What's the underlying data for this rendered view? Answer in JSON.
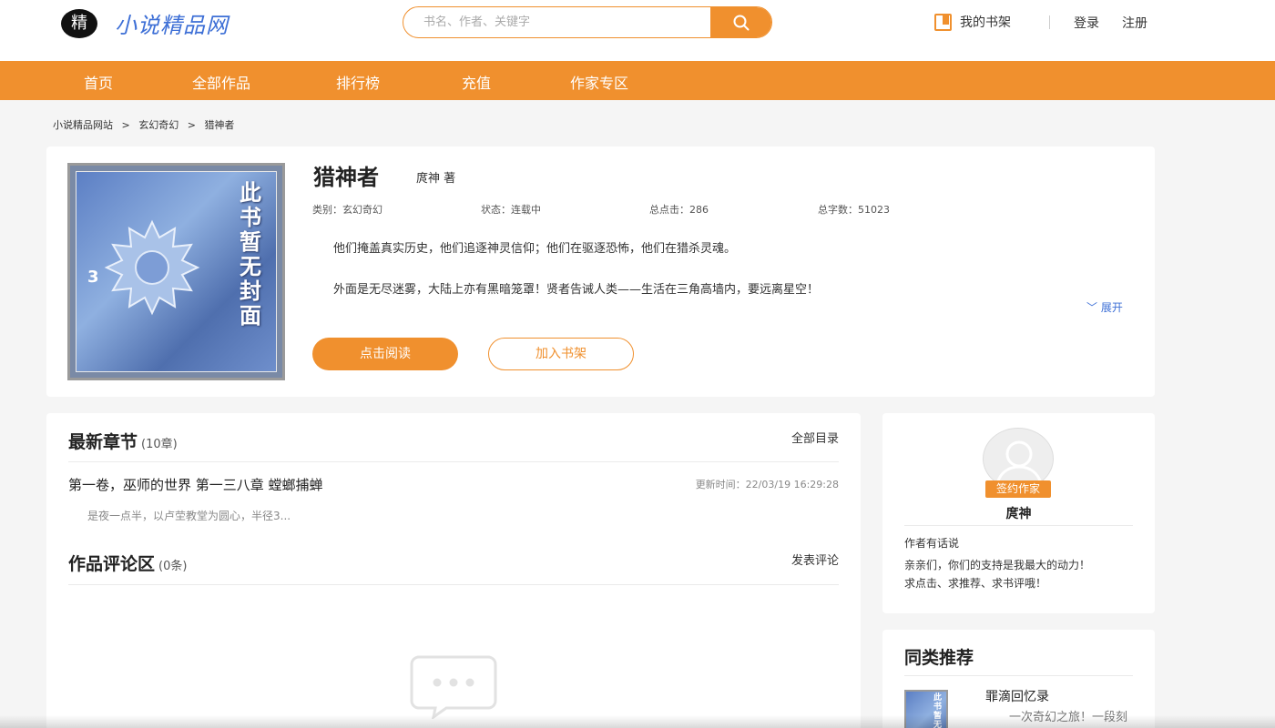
{
  "header": {
    "logo_badge": "精",
    "logo_text": "小说精品网",
    "search_placeholder": "书名、作者、关键字",
    "shelf_label": "我的书架",
    "login": "登录",
    "register": "注册"
  },
  "nav": {
    "items": [
      "首页",
      "全部作品",
      "排行榜",
      "充值",
      "作家专区"
    ]
  },
  "breadcrumb": [
    "小说精品网站",
    ">",
    "玄幻奇幻",
    ">",
    "猎神者"
  ],
  "book": {
    "title": "猎神者",
    "author": "庹神 著",
    "category": "类别：玄幻奇幻",
    "status": "状态：连载中",
    "clicks": "总点击：286",
    "words": "总字数：51023",
    "intro_1": "他们掩盖真实历史，他们追逐神灵信仰；他们在驱逐恐怖，他们在猎杀灵魂。",
    "intro_2": "外面是无尽迷雾，大陆上亦有黑暗笼罩！贤者告诫人类——生活在三角高墙内，要远离星空！",
    "expand": "展开",
    "read_btn": "点击阅读",
    "shelf_btn": "加入书架",
    "cover_text": "此书暂无封面",
    "cover_num": "3"
  },
  "latest": {
    "title": "最新章节",
    "count": "(10章)",
    "all_link": "全部目录",
    "chapter_title": "第一卷，巫师的世界 第一三八章 螳螂捕蝉",
    "update_time": "更新时间：22/03/19 16:29:28",
    "excerpt": "是夜一点半，以卢茔教堂为圆心，半径3..."
  },
  "comments": {
    "title": "作品评论区",
    "count": "(0条)",
    "post_link": "发表评论"
  },
  "author": {
    "badge": "签约作家",
    "name": "庹神",
    "says_label": "作者有话说",
    "msg_1": "亲亲们，你们的支持是我最大的动力！",
    "msg_2": "求点击、求推荐、求书评哦！"
  },
  "recommend": {
    "title": "同类推荐",
    "book_title": "罪滴回忆录",
    "book_desc": "一次奇幻之旅！一段刻骨铭心的回忆",
    "cover_text": "此书暂无"
  },
  "colors": {
    "accent": "#f0902e",
    "link": "#3d6fd6"
  }
}
